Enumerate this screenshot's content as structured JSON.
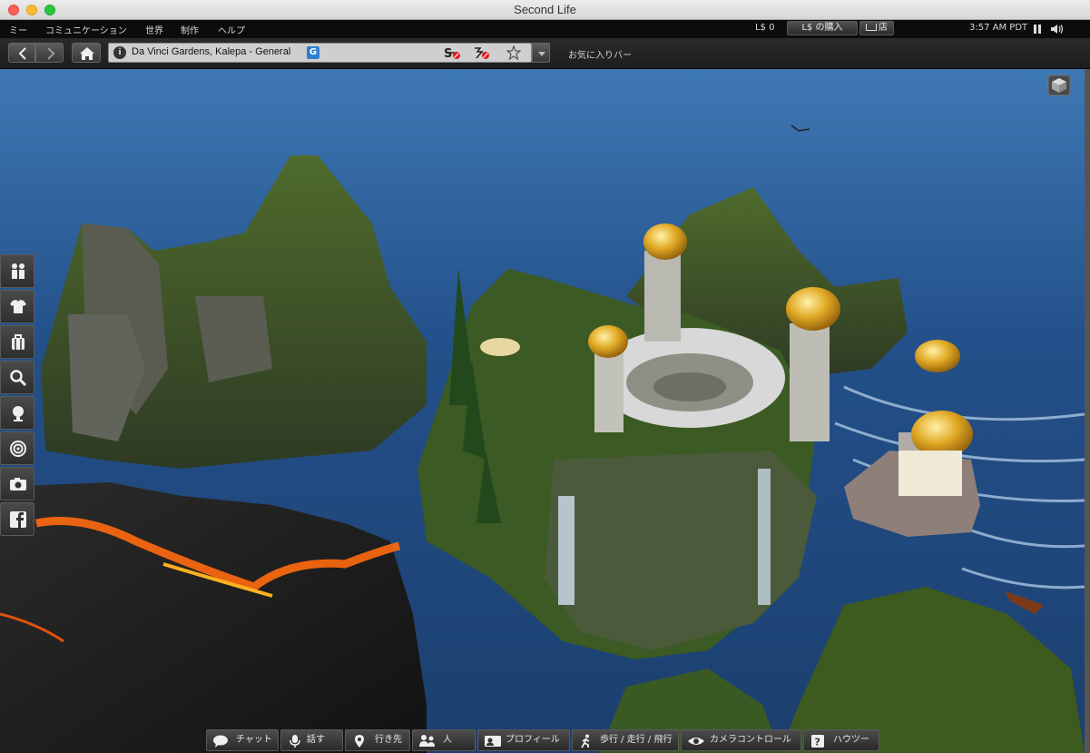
{
  "window": {
    "title": "Second Life"
  },
  "menu": {
    "items": [
      "ミー",
      "コミュニケーション",
      "世界",
      "制作",
      "ヘルプ"
    ],
    "balance": "L$ 0",
    "buy_label": "L$ の購入",
    "shop_label": "店",
    "time": "3:57 AM PDT"
  },
  "nav": {
    "location": "Da Vinci Gardens, Kalepa - General",
    "maturity_badge": "G",
    "favorites_bar": "お気に入りバー"
  },
  "sidebar": {
    "items": [
      "people-icon",
      "appearance-icon",
      "inventory-icon",
      "search-icon",
      "avatar-icon",
      "places-icon",
      "snapshot-icon",
      "facebook-icon"
    ]
  },
  "bottom_bar": {
    "chat": "チャット",
    "speak": "話す",
    "destinations": "行き先",
    "people": "人",
    "profile": "プロフィール",
    "move": "歩行 / 走行 / 飛行",
    "camera": "カメラコントロール",
    "howto": "ハウツー"
  },
  "colors": {
    "ocean": "#2a5f9c",
    "lava": "#ff6a10",
    "dome_gold": "#d9a21b",
    "toolbar": "#2b2b2b"
  }
}
